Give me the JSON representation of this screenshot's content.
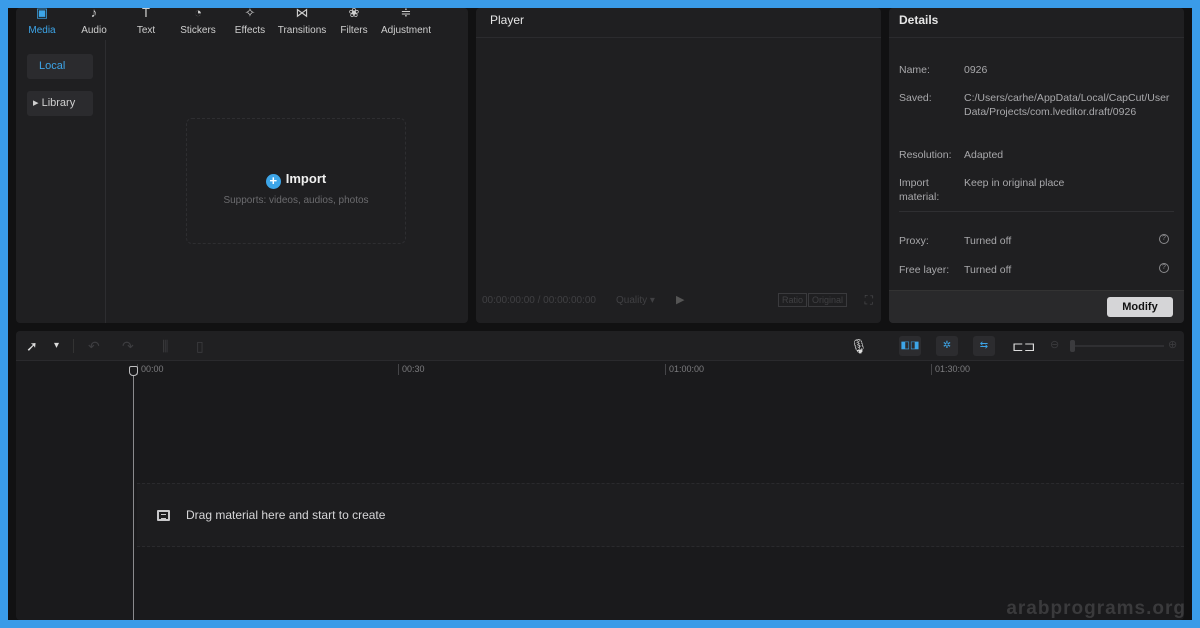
{
  "media": {
    "tabs": [
      {
        "label": "Media",
        "icon": "media-icon"
      },
      {
        "label": "Audio",
        "icon": "music-note-icon"
      },
      {
        "label": "Text",
        "icon": "text-icon"
      },
      {
        "label": "Stickers",
        "icon": "sticker-icon"
      },
      {
        "label": "Effects",
        "icon": "sparkle-icon"
      },
      {
        "label": "Transitions",
        "icon": "transition-icon"
      },
      {
        "label": "Filters",
        "icon": "filter-icon"
      },
      {
        "label": "Adjustment",
        "icon": "sliders-icon"
      }
    ],
    "active_tab": "Media",
    "sidebar": {
      "local": "Local",
      "library": "Library"
    },
    "import_label": "Import",
    "import_hint": "Supports: videos, audios, photos"
  },
  "player": {
    "title": "Player",
    "timecode": "00:00:00:00 / 00:00:00:00",
    "quality": "Quality",
    "ratio": "Ratio",
    "original": "Original"
  },
  "details": {
    "title": "Details",
    "rows": [
      {
        "label": "Name:",
        "value": "0926"
      },
      {
        "label": "Saved:",
        "value": "C:/Users/carhe/AppData/Local/CapCut/User Data/Projects/com.lveditor.draft/0926"
      },
      {
        "label": "Resolution:",
        "value": "Adapted"
      },
      {
        "label": "Import material:",
        "value": "Keep in original place"
      },
      {
        "label": "Proxy:",
        "value": "Turned off"
      },
      {
        "label": "Free layer:",
        "value": "Turned off"
      }
    ],
    "modify_label": "Modify"
  },
  "timeline": {
    "ruler": [
      "00:00",
      "00:30",
      "01:00:00",
      "01:30:00"
    ],
    "empty_hint": "Drag material here and start to create"
  },
  "watermark": "arabprograms.org",
  "colors": {
    "accent": "#3da5e8",
    "frame": "#3a9be8",
    "panel": "#1f1f21",
    "background": "#111112"
  }
}
